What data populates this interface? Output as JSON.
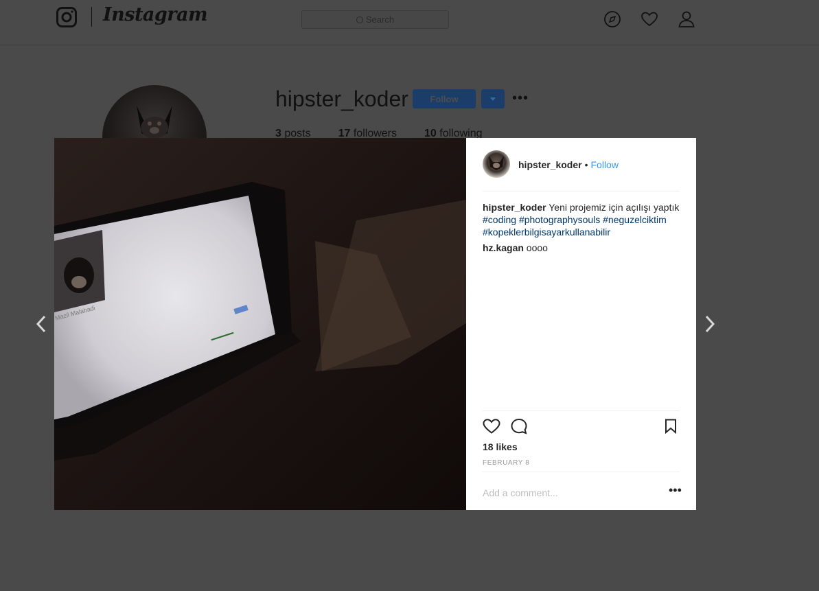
{
  "app": {
    "wordmark": "Instagram"
  },
  "search": {
    "placeholder": "Search"
  },
  "nav": {
    "icons": [
      "compass-icon",
      "heart-icon",
      "user-icon"
    ]
  },
  "profile": {
    "username": "hipster_koder",
    "follow_label": "Follow",
    "stats": [
      {
        "count": "3",
        "label": "posts"
      },
      {
        "count": "17",
        "label": "followers"
      },
      {
        "count": "10",
        "label": "following"
      }
    ]
  },
  "post": {
    "author": "hipster_koder",
    "separator": "•",
    "follow_label": "Follow",
    "caption_text": "Yeni projemiz için açılışı yaptık",
    "hashtags": [
      "#coding",
      "#photographysouls",
      "#neguzelciktim",
      "#kopeklerbilgisayarkullanabilir"
    ],
    "comments": [
      {
        "user": "hz.kagan",
        "text": "oooo"
      }
    ],
    "likes": "18 likes",
    "date": "FEBRUARY 8",
    "comment_placeholder": "Add a comment..."
  },
  "photo_screen": {
    "profile_name": "Mazil Malabadi"
  },
  "colors": {
    "link": "#3897f0",
    "hashtag": "#003569",
    "follow_button": "#3897f0",
    "overlay": "#4a4a4a"
  }
}
